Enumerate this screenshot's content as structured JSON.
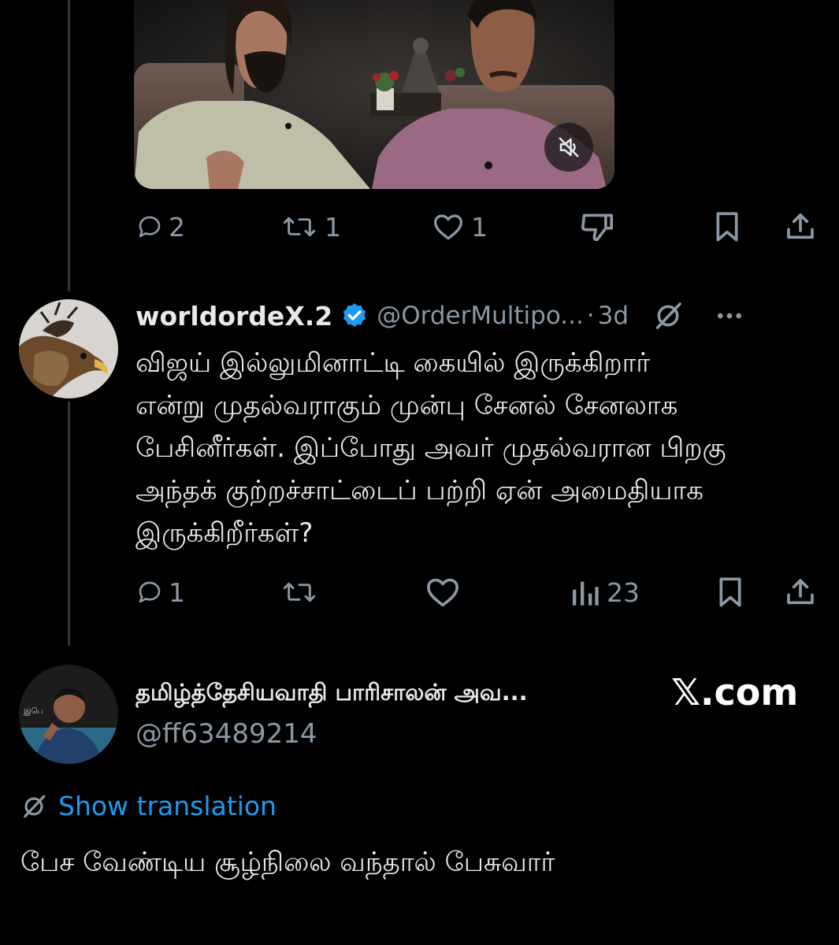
{
  "first_tweet": {
    "video": {
      "mute_icon": "speaker-muted-icon"
    },
    "actions": {
      "replies": "2",
      "reposts": "1",
      "likes": "1",
      "dislike_icon": "thumbs-down-icon",
      "bookmark_icon": "bookmark-icon",
      "share_icon": "share-icon"
    }
  },
  "reply_tweet": {
    "display_name": "worldordeX.2",
    "verified_icon": "verified-badge-icon",
    "handle": "@OrderMultipo...",
    "separator": "·",
    "time": "3d",
    "grok_icon": "grok-icon",
    "more_icon": "more-icon",
    "text": "விஜய் இல்லுமினாட்டி கையில் இருக்கிறார்\nஎன்று முதல்வராகும் முன்பு சேனல் சேனலாக\nபேசினீர்கள். இப்போது அவர் முதல்வரான பிறகு\nஅந்தக் குற்றச்சாட்டைப் பற்றி ஏன் அமைதியாக\nஇருக்கிறீர்கள்?",
    "actions": {
      "replies": "1",
      "reposts": "",
      "likes": "",
      "views": "23",
      "bookmark_icon": "bookmark-icon",
      "share_icon": "share-icon"
    }
  },
  "embed_tweet": {
    "display_name": "தமிழ்த்தேசியவாதி பாரிசாலன் அவ...",
    "handle": "@ff63489214",
    "source": "𝕏.com",
    "translate_icon": "translate-globe-icon",
    "translation_label": "Show translation",
    "text": "பேச வேண்டிய சூழ்நிலை வந்தால் பேசுவார்"
  },
  "colors": {
    "background": "#000000",
    "text": "#e7e9ea",
    "muted": "#8b98a5",
    "link": "#1d9bf0",
    "verified": "#1d9bf0",
    "thread_line": "#333639"
  }
}
